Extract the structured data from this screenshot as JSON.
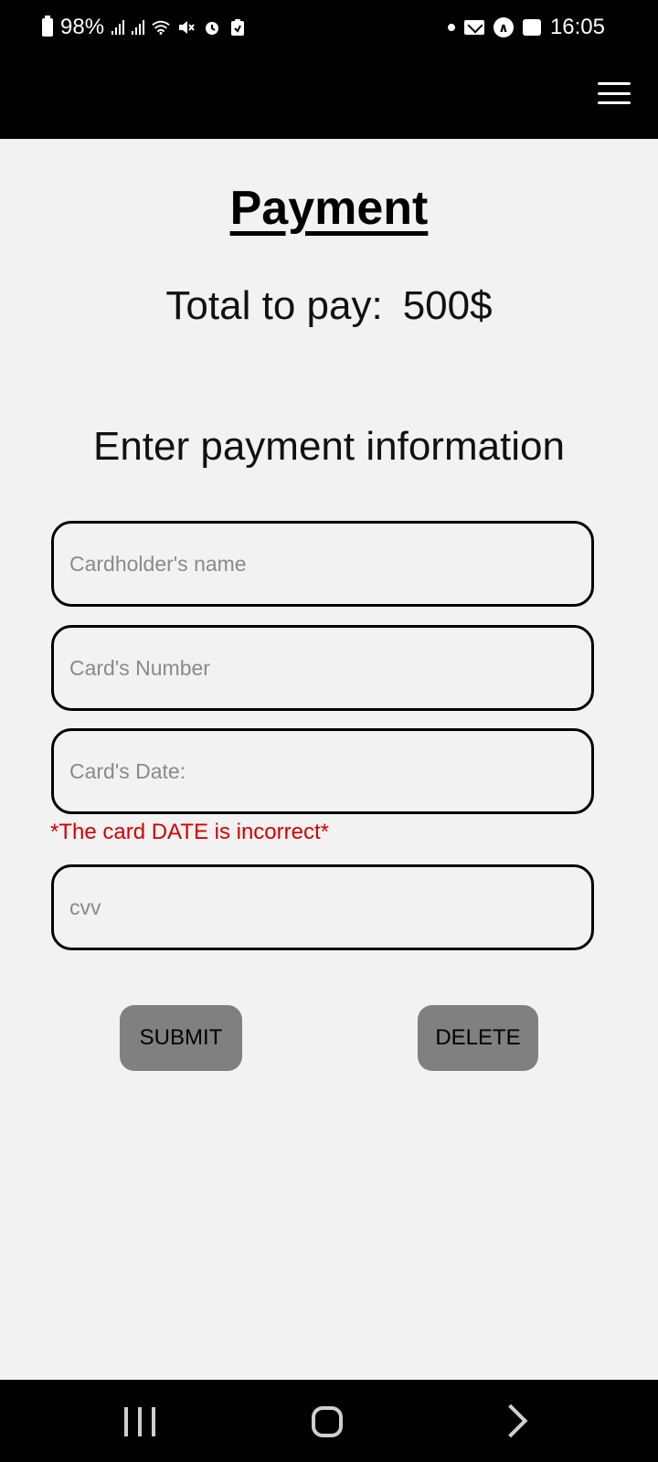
{
  "status_bar": {
    "battery": "98%",
    "time": "16:05"
  },
  "page": {
    "title": "Payment",
    "total_label": "Total to pay:",
    "total_amount": "500$",
    "subheading": "Enter payment information"
  },
  "form": {
    "cardholder_name": {
      "value": "",
      "placeholder": "Cardholder's name"
    },
    "card_number": {
      "value": "",
      "placeholder": "Card's Number"
    },
    "card_date": {
      "value": "",
      "placeholder": "Card's Date:"
    },
    "card_date_error": "*The card DATE is incorrect*",
    "cvv": {
      "value": "",
      "placeholder": "cvv"
    },
    "submit_label": "SUBMIT",
    "delete_label": "DELETE"
  },
  "colors": {
    "background": "#f2f2f2",
    "bars": "#000000",
    "error": "#d40000",
    "button": "#808080"
  },
  "icons": {
    "status_left": [
      "battery-icon",
      "signal-icon",
      "signal-icon",
      "wifi-icon",
      "mute-icon",
      "alarm-icon",
      "clipboard-icon"
    ],
    "status_right": [
      "notification-dot-icon",
      "mail-icon",
      "app-icon",
      "gallery-icon"
    ],
    "header": "menu-icon",
    "navigation": [
      "recents-icon",
      "home-icon",
      "back-icon"
    ]
  }
}
